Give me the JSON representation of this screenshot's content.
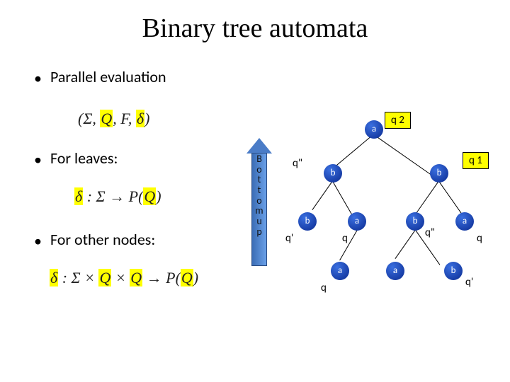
{
  "title": "Binary tree automata",
  "bullets": {
    "parallel": "Parallel evaluation",
    "leaves": "For leaves:",
    "other": "For other nodes:"
  },
  "formulas": {
    "signature_open": "(Σ, ",
    "signature_Q": "Q",
    "signature_mid": ", F, ",
    "signature_delta": "δ",
    "signature_close": ")",
    "leaf_delta": "δ",
    "leaf_colon": " : Σ → P(",
    "leaf_Q": "Q",
    "leaf_close": ")",
    "node_delta": "δ",
    "node_sig": " : Σ × ",
    "node_Q1": "Q",
    "node_x": " × ",
    "node_Q2": "Q",
    "node_arrow": " → P(",
    "node_Q3": "Q",
    "node_close2": ")"
  },
  "arrow_letters": [
    "B",
    "o",
    "t",
    "t",
    "o",
    "m",
    "u",
    "p"
  ],
  "box": {
    "q2": "q 2",
    "q1": "q 1"
  },
  "labels": {
    "qpp": "q\"",
    "qp": "q'",
    "q": "q"
  },
  "nodes": {
    "a": "a",
    "b": "b"
  }
}
